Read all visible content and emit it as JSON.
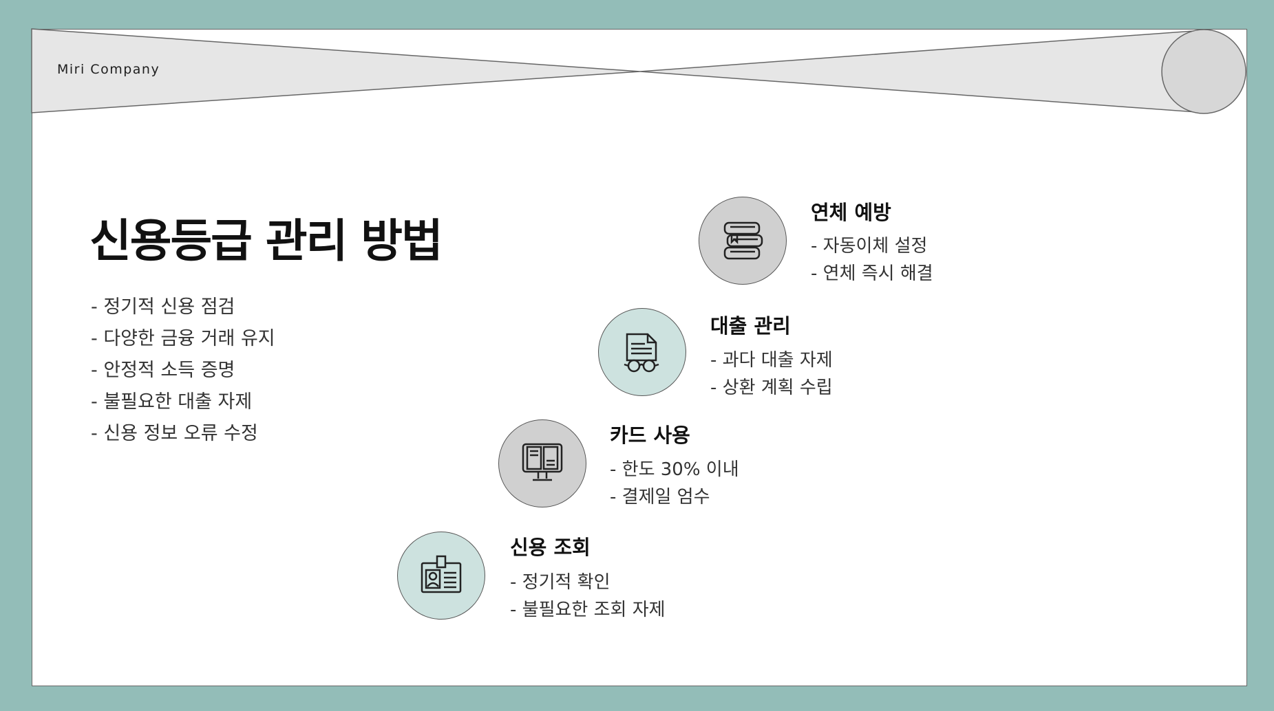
{
  "header": {
    "company": "Miri Company"
  },
  "main": {
    "title": "신용등급 관리 방법",
    "tips": [
      "- 정기적 신용 점검",
      "- 다양한 금융 거래 유지",
      "- 안정적 소득 증명",
      "- 불필요한 대출 자제",
      "- 신용 정보 오류 수정"
    ]
  },
  "steps": [
    {
      "title": "연체 예방",
      "lines": [
        "- 자동이체 설정",
        "- 연체 즉시 해결"
      ],
      "icon": "books-icon",
      "circle_color": "#d0d0d0"
    },
    {
      "title": "대출 관리",
      "lines": [
        "- 과다 대출 자제",
        "- 상환 계획 수립"
      ],
      "icon": "document-glasses-icon",
      "circle_color": "#cde2df"
    },
    {
      "title": "카드 사용",
      "lines": [
        "- 한도 30% 이내",
        "- 결제일 엄수"
      ],
      "icon": "ebook-monitor-icon",
      "circle_color": "#d0d0d0"
    },
    {
      "title": "신용 조회",
      "lines": [
        "- 정기적 확인",
        "- 불필요한 조회 자제"
      ],
      "icon": "id-card-icon",
      "circle_color": "#cde2df"
    }
  ],
  "colors": {
    "background": "#93bdb8",
    "slide": "#ffffff",
    "banner": "#e6e6e6",
    "circle_gray": "#d0d0d0",
    "circle_teal": "#cde2df"
  }
}
